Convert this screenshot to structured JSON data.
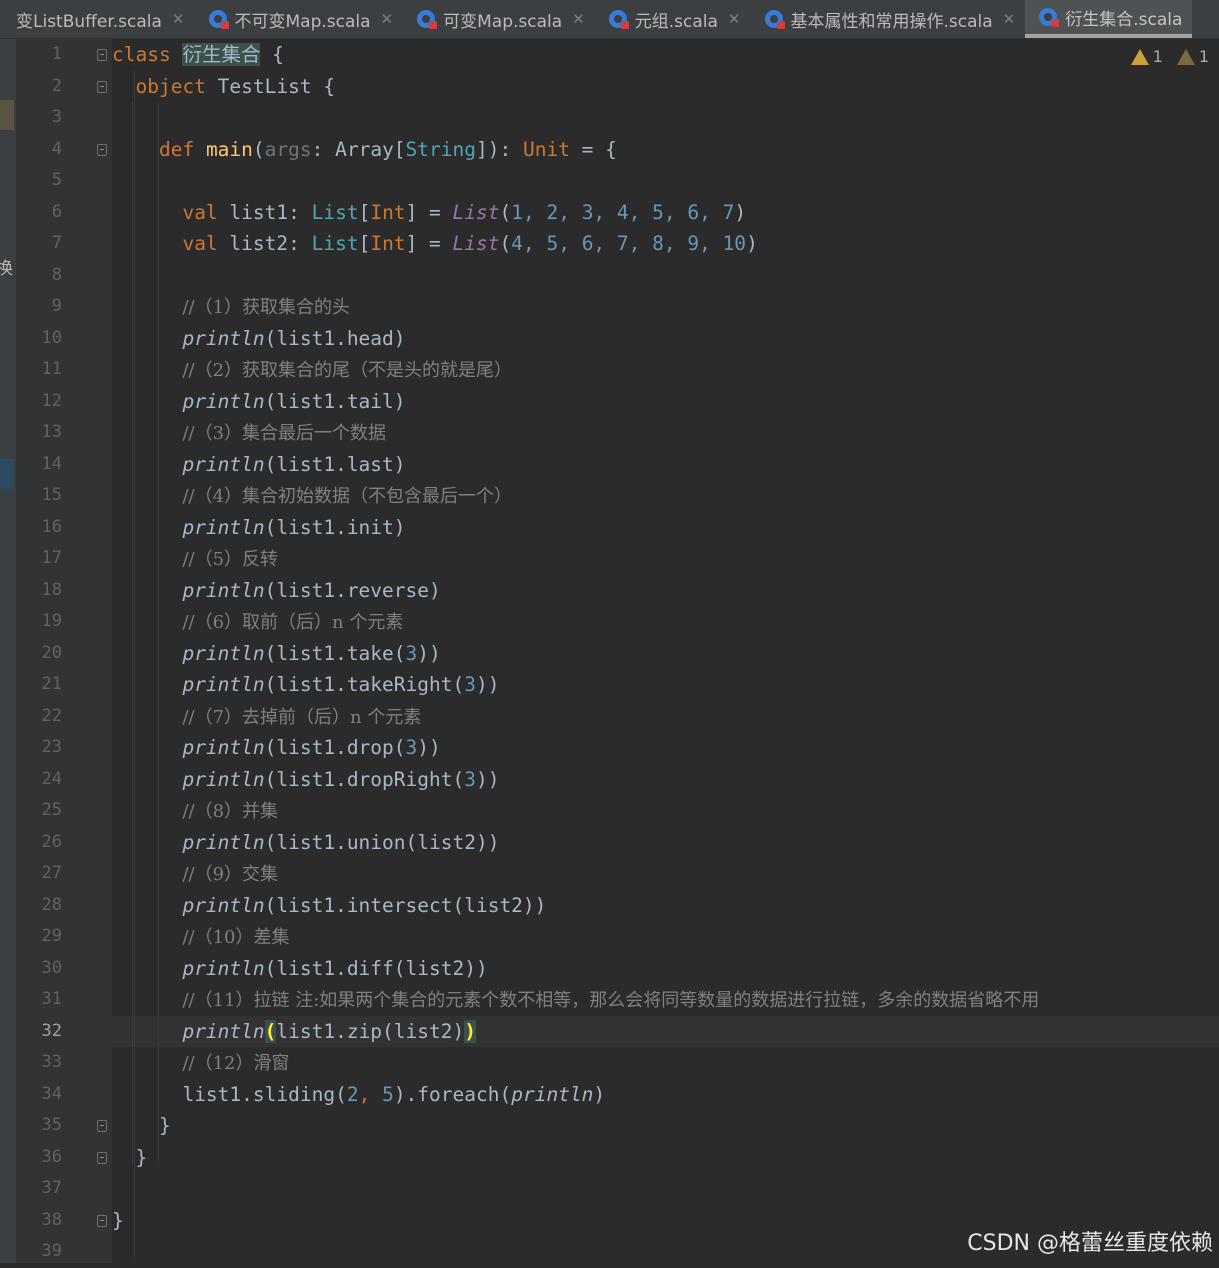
{
  "tabs": [
    {
      "label": "变ListBuffer.scala",
      "active": false,
      "icon": "scala-file-icon",
      "closable": true
    },
    {
      "label": "不可变Map.scala",
      "active": false,
      "icon": "scala-file-icon",
      "closable": true
    },
    {
      "label": "可变Map.scala",
      "active": false,
      "icon": "scala-file-icon",
      "closable": true
    },
    {
      "label": "元组.scala",
      "active": false,
      "icon": "scala-file-icon",
      "closable": true
    },
    {
      "label": "基本属性和常用操作.scala",
      "active": false,
      "icon": "scala-file-icon",
      "closable": true
    },
    {
      "label": "衍生集合.scala",
      "active": true,
      "icon": "scala-file-icon",
      "closable": false
    }
  ],
  "close_glyph": "✕",
  "left_strip_glyph": "换",
  "warnings": [
    {
      "icon": "warning-icon",
      "count": "1"
    },
    {
      "icon": "weak-warning-icon",
      "count": "1"
    }
  ],
  "current_line": 32,
  "line_numbers": [
    "1",
    "2",
    "3",
    "4",
    "5",
    "6",
    "7",
    "8",
    "9",
    "10",
    "11",
    "12",
    "13",
    "14",
    "15",
    "16",
    "17",
    "18",
    "19",
    "20",
    "21",
    "22",
    "23",
    "24",
    "25",
    "26",
    "27",
    "28",
    "29",
    "30",
    "31",
    "32",
    "33",
    "34",
    "35",
    "36",
    "37",
    "38",
    "39"
  ],
  "code": {
    "l1": {
      "kw": "class ",
      "name": "衍生集合",
      "rest": " {"
    },
    "l2": {
      "kw": "object ",
      "rest": "TestList {"
    },
    "l4": {
      "kw": "def ",
      "fn": "main",
      "p1": "(",
      "param": "args",
      "p2": ": Array[",
      "tp": "String",
      "p3": "]): ",
      "unit": "Unit",
      "p4": " = {"
    },
    "l6": {
      "kw": "val ",
      "a": "list1: ",
      "t1": "List",
      "b": "[",
      "t2": "Int",
      "c": "] = ",
      "ctor": "List",
      "d": "(",
      "nums": "1, 2, 3, 4, 5, 6, 7",
      "e": ")"
    },
    "l7": {
      "kw": "val ",
      "a": "list2: ",
      "t1": "List",
      "b": "[",
      "t2": "Int",
      "c": "] = ",
      "ctor": "List",
      "d": "(",
      "nums": "4, 5, 6, 7, 8, 9, 10",
      "e": ")"
    },
    "l9": "//（1）获取集合的头",
    "l10": {
      "fn": "println",
      "rest": "(list1.head)"
    },
    "l11": "//（2）获取集合的尾（不是头的就是尾）",
    "l12": {
      "fn": "println",
      "rest": "(list1.tail)"
    },
    "l13": "//（3）集合最后一个数据",
    "l14": {
      "fn": "println",
      "rest": "(list1.last)"
    },
    "l15": "//（4）集合初始数据（不包含最后一个）",
    "l16": {
      "fn": "println",
      "rest": "(list1.init)"
    },
    "l17": "//（5）反转",
    "l18": {
      "fn": "println",
      "rest": "(list1.reverse)"
    },
    "l19": "//（6）取前（后）n 个元素",
    "l20": {
      "fn": "println",
      "a": "(list1.take(",
      "n": "3",
      "b": "))"
    },
    "l21": {
      "fn": "println",
      "a": "(list1.takeRight(",
      "n": "3",
      "b": "))"
    },
    "l22": "//（7）去掉前（后）n 个元素",
    "l23": {
      "fn": "println",
      "a": "(list1.drop(",
      "n": "3",
      "b": "))"
    },
    "l24": {
      "fn": "println",
      "a": "(list1.dropRight(",
      "n": "3",
      "b": "))"
    },
    "l25": "//（8）并集",
    "l26": {
      "fn": "println",
      "rest": "(list1.union(list2))"
    },
    "l27": "//（9）交集",
    "l28": {
      "fn": "println",
      "rest": "(list1.intersect(list2))"
    },
    "l29": "//（10）差集",
    "l30": {
      "fn": "println",
      "rest": "(list1.diff(list2))"
    },
    "l31": "//（11）拉链 注:如果两个集合的元素个数不相等，那么会将同等数量的数据进行拉链，多余的数据省略不用",
    "l32": {
      "fn": "println",
      "open": "(",
      "mid": "list1.zip(list2)",
      "close": ")"
    },
    "l33": "//（12）滑窗",
    "l34": {
      "a": "list1.sliding(",
      "n1": "2",
      "b": ", ",
      "n2": "5",
      "c": ").foreach(",
      "fn": "println",
      "d": ")"
    },
    "l35": "}",
    "l36": "}",
    "l38": "}"
  },
  "watermark": "CSDN @格蕾丝重度依赖"
}
